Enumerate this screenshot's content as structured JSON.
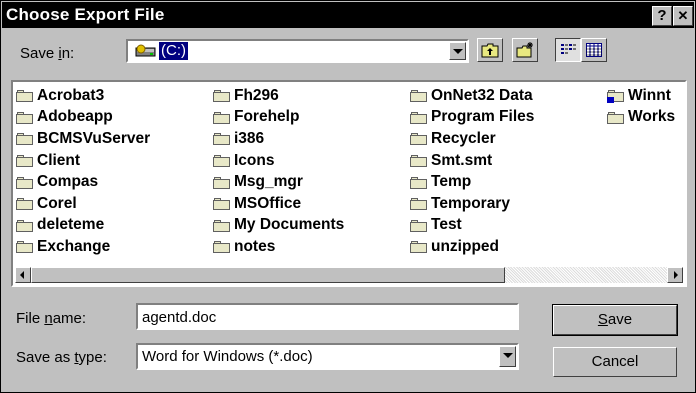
{
  "window": {
    "title": "Choose Export File",
    "help_label": "?",
    "close_label": "✕"
  },
  "save_in": {
    "label_pre": "Save ",
    "label_key": "i",
    "label_post": "n:",
    "value": "(C:)",
    "icon": "drive-icon"
  },
  "toolbar": {
    "up_folder_icon": "up-folder-icon",
    "new_folder_icon": "new-folder-icon",
    "list_view_icon": "list-view-icon",
    "details_view_icon": "details-view-icon"
  },
  "files": {
    "col1": [
      "Acrobat3",
      "Adobeapp",
      "BCMSVuServer",
      "Client",
      "Compas",
      "Corel",
      "deleteme",
      "Exchange"
    ],
    "col2": [
      "Fh296",
      "Forehelp",
      "i386",
      "Icons",
      "Msg_mgr",
      "MSOffice",
      "My Documents",
      "notes"
    ],
    "col3": [
      "OnNet32 Data",
      "Program Files",
      "Recycler",
      "Smt.smt",
      "Temp",
      "Temporary",
      "Test",
      "unzipped"
    ],
    "col4": [
      "Winnt",
      "Works"
    ]
  },
  "file_name": {
    "label_pre": "File ",
    "label_key": "n",
    "label_post": "ame:",
    "value": "agentd.doc"
  },
  "save_as_type": {
    "label_pre": "Save as ",
    "label_key": "t",
    "label_post": "ype:",
    "value": "Word for Windows (*.doc)"
  },
  "buttons": {
    "save_key": "S",
    "save_rest": "ave",
    "cancel": "Cancel"
  }
}
